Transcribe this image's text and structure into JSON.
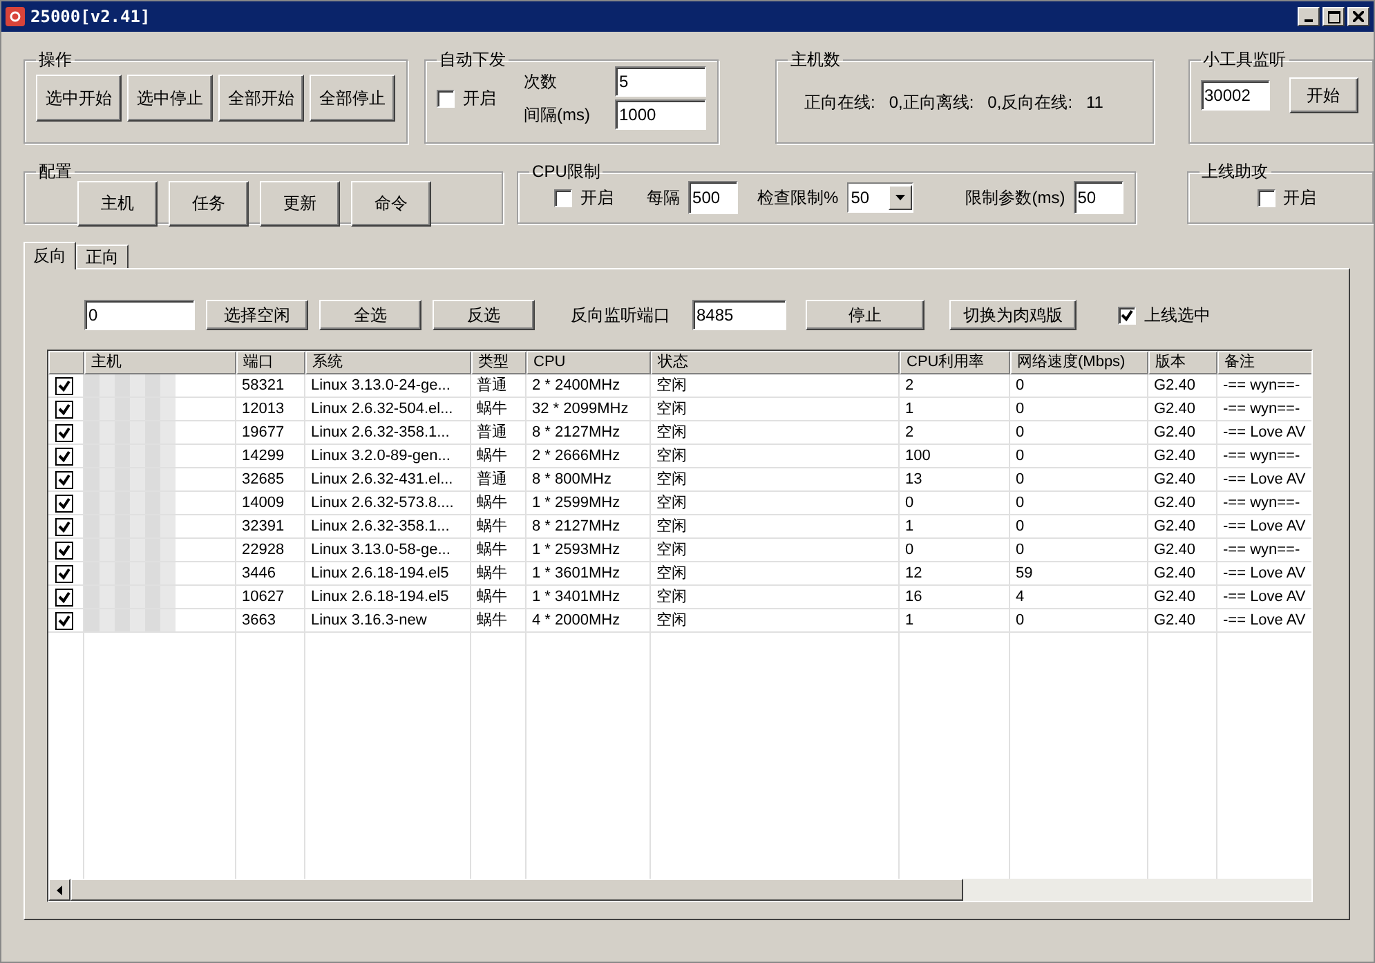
{
  "window": {
    "title": "25000[v2.41]"
  },
  "operations": {
    "title": "操作",
    "buttons": [
      "选中开始",
      "选中停止",
      "全部开始",
      "全部停止"
    ]
  },
  "auto_send": {
    "title": "自动下发",
    "enable": {
      "label": "开启",
      "checked": false
    },
    "count_label": "次数",
    "count_value": "5",
    "interval_label": "间隔(ms)",
    "interval_value": "1000"
  },
  "host_count": {
    "title": "主机数",
    "summary": "正向在线:   0,正向离线:   0,反向在线:   11"
  },
  "tool_listen": {
    "title": "小工具监听",
    "port": "30002",
    "button": "开始"
  },
  "config": {
    "title": "配置",
    "buttons": [
      "主机",
      "任务",
      "更新",
      "命令"
    ]
  },
  "cpu_limit": {
    "title": "CPU限制",
    "enable": {
      "label": "开启",
      "checked": false
    },
    "every_label": "每隔",
    "every_value": "500",
    "check_label": "检查限制%",
    "check_value": "50",
    "param_label": "限制参数(ms)",
    "param_value": "50"
  },
  "online_assist": {
    "title": "上线助攻",
    "enable": {
      "label": "开启",
      "checked": false
    }
  },
  "tabs": [
    {
      "label": "反向",
      "selected": true
    },
    {
      "label": "正向",
      "selected": false
    }
  ],
  "toolbar": {
    "filter_value": "0",
    "buttons": [
      "选择空闲",
      "全选",
      "反选"
    ],
    "port_label": "反向监听端口",
    "port_value": "8485",
    "stop_button": "停止",
    "switch_button": "切换为肉鸡版",
    "select_online": {
      "label": "上线选中",
      "checked": true
    }
  },
  "table": {
    "columns": [
      "主机",
      "端口",
      "系统",
      "类型",
      "CPU",
      "状态",
      "CPU利用率",
      "网络速度(Mbps)",
      "版本",
      "备注"
    ],
    "rows": [
      {
        "checked": true,
        "cells": [
          "",
          "58321",
          "Linux 3.13.0-24-ge...",
          "普通",
          "2 * 2400MHz",
          "空闲",
          "2",
          "0",
          "G2.40",
          "-== wyn==-"
        ]
      },
      {
        "checked": true,
        "cells": [
          "",
          "12013",
          "Linux 2.6.32-504.el...",
          "蜗牛",
          "32 * 2099MHz",
          "空闲",
          "1",
          "0",
          "G2.40",
          "-== wyn==-"
        ]
      },
      {
        "checked": true,
        "cells": [
          "",
          "19677",
          "Linux 2.6.32-358.1...",
          "普通",
          "8 * 2127MHz",
          "空闲",
          "2",
          "0",
          "G2.40",
          "-== Love AV"
        ]
      },
      {
        "checked": true,
        "cells": [
          "",
          "14299",
          "Linux 3.2.0-89-gen...",
          "蜗牛",
          "2 * 2666MHz",
          "空闲",
          "100",
          "0",
          "G2.40",
          "-== wyn==-"
        ]
      },
      {
        "checked": true,
        "cells": [
          "",
          "32685",
          "Linux 2.6.32-431.el...",
          "普通",
          "8 * 800MHz",
          "空闲",
          "13",
          "0",
          "G2.40",
          "-== Love AV"
        ]
      },
      {
        "checked": true,
        "cells": [
          "",
          "14009",
          "Linux 2.6.32-573.8....",
          "蜗牛",
          "1 * 2599MHz",
          "空闲",
          "0",
          "0",
          "G2.40",
          "-== wyn==-"
        ]
      },
      {
        "checked": true,
        "cells": [
          "",
          "32391",
          "Linux 2.6.32-358.1...",
          "蜗牛",
          "8 * 2127MHz",
          "空闲",
          "1",
          "0",
          "G2.40",
          "-== Love AV"
        ]
      },
      {
        "checked": true,
        "cells": [
          "",
          "22928",
          "Linux 3.13.0-58-ge...",
          "蜗牛",
          "1 * 2593MHz",
          "空闲",
          "0",
          "0",
          "G2.40",
          "-== wyn==-"
        ]
      },
      {
        "checked": true,
        "cells": [
          "",
          "3446",
          "Linux 2.6.18-194.el5",
          "蜗牛",
          "1 * 3601MHz",
          "空闲",
          "12",
          "59",
          "G2.40",
          "-== Love AV"
        ]
      },
      {
        "checked": true,
        "cells": [
          "",
          "10627",
          "Linux 2.6.18-194.el5",
          "蜗牛",
          "1 * 3401MHz",
          "空闲",
          "16",
          "4",
          "G2.40",
          "-== Love AV"
        ]
      },
      {
        "checked": true,
        "cells": [
          "",
          "3663",
          "Linux 3.16.3-new",
          "蜗牛",
          "4 * 2000MHz",
          "空闲",
          "1",
          "0",
          "G2.40",
          "-== Love AV"
        ]
      }
    ]
  }
}
